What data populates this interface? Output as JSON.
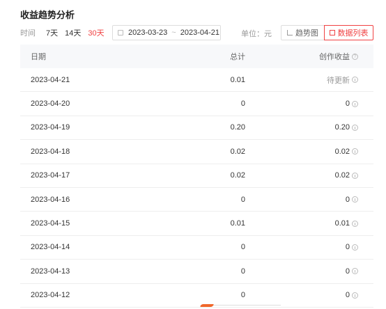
{
  "page": {
    "title": "收益趋势分析"
  },
  "filters": {
    "label": "时间",
    "options": [
      "7天",
      "14天",
      "30天"
    ],
    "active": "30天"
  },
  "date_range": {
    "start": "2023-03-23",
    "separator": "~",
    "end": "2023-04-21"
  },
  "unit": "单位：元",
  "view_buttons": {
    "trend": "趋势图",
    "list": "数据列表",
    "active": "数据列表"
  },
  "table": {
    "headers": {
      "date": "日期",
      "total": "总计",
      "earnings": "创作收益"
    },
    "rows": [
      {
        "date": "2023-04-21",
        "total": "0.01",
        "earnings": "待更新"
      },
      {
        "date": "2023-04-20",
        "total": "0",
        "earnings": "0"
      },
      {
        "date": "2023-04-19",
        "total": "0.20",
        "earnings": "0.20"
      },
      {
        "date": "2023-04-18",
        "total": "0.02",
        "earnings": "0.02"
      },
      {
        "date": "2023-04-17",
        "total": "0.02",
        "earnings": "0.02"
      },
      {
        "date": "2023-04-16",
        "total": "0",
        "earnings": "0"
      },
      {
        "date": "2023-04-15",
        "total": "0.01",
        "earnings": "0.01"
      },
      {
        "date": "2023-04-14",
        "total": "0",
        "earnings": "0"
      },
      {
        "date": "2023-04-13",
        "total": "0",
        "earnings": "0"
      },
      {
        "date": "2023-04-12",
        "total": "0",
        "earnings": "0"
      }
    ]
  },
  "colors": {
    "accent": "#f04142",
    "header_bg": "#f7f8fa",
    "pending": "#999999"
  }
}
